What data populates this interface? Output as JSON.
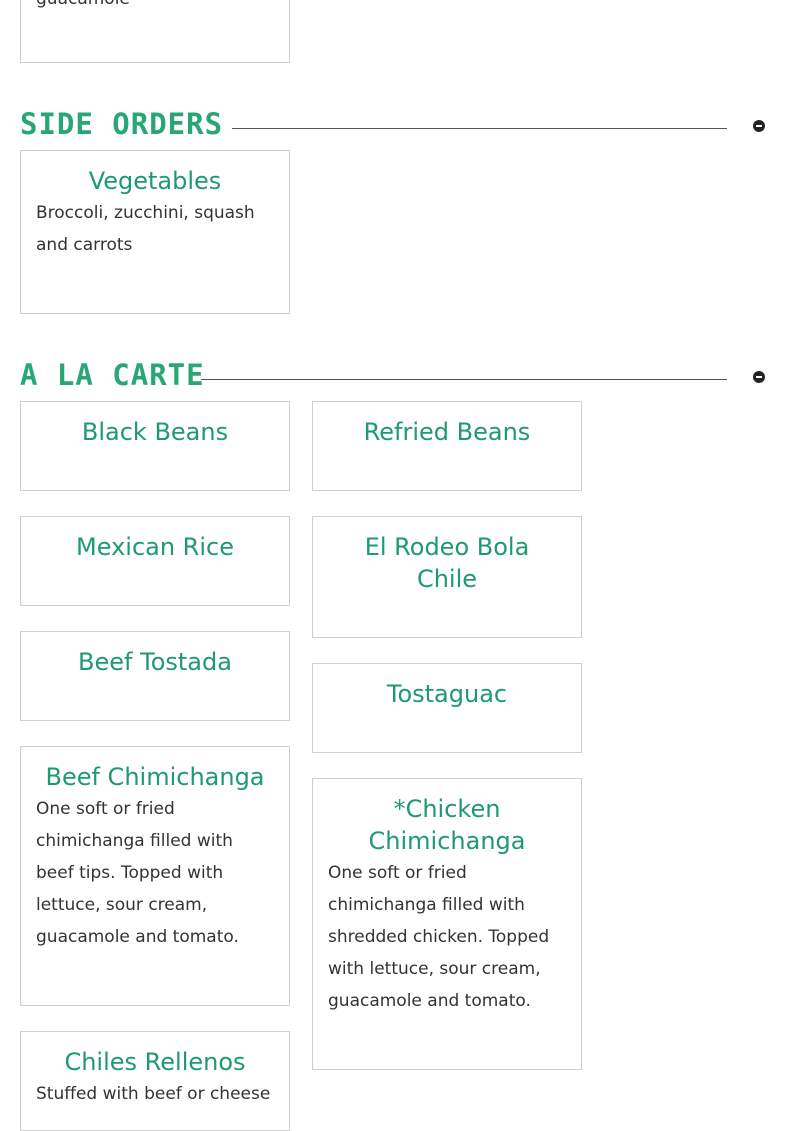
{
  "top_card": {
    "desc_tail": "guacamole"
  },
  "sections": [
    {
      "title": "SIDE ORDERS",
      "items": [
        {
          "name": "Vegetables",
          "desc": "Broccoli, zucchini, squash and carrots"
        }
      ]
    },
    {
      "title": "A LA CARTE",
      "items": [
        {
          "name": "Black Beans"
        },
        {
          "name": "Refried Beans"
        },
        {
          "name": "Mexican Rice"
        },
        {
          "name": "El Rodeo Bola Chile"
        },
        {
          "name": "Beef Tostada"
        },
        {
          "name": "Tostaguac"
        },
        {
          "name": "Beef Chimichanga",
          "desc": "One soft or fried chimichanga filled with beef tips. Topped with lettuce, sour cream, guacamole and tomato."
        },
        {
          "name": "*Chicken Chimichanga",
          "desc": "One soft or fried chimichanga filled with shredded chicken. Topped with lettuce, sour cream, guacamole and tomato."
        },
        {
          "name": "Chiles Rellenos",
          "desc": "Stuffed with beef or cheese"
        }
      ]
    }
  ],
  "colors": {
    "accent": "#1e9a6e",
    "heading": "#28a673",
    "border": "#cfcfcf"
  },
  "icons": {
    "toggle": "minus-circle-icon"
  }
}
